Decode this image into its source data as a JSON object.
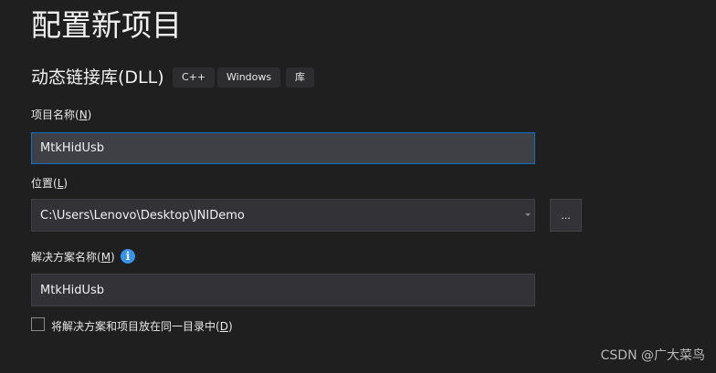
{
  "title": "配置新项目",
  "subtitle": "动态链接库(DLL)",
  "tags": [
    "C++",
    "Windows",
    "库"
  ],
  "project_name": {
    "label_pre": "项目名称(",
    "key": "N",
    "label_post": ")",
    "value": "MtkHidUsb"
  },
  "location": {
    "label_pre": "位置(",
    "key": "L",
    "label_post": ")",
    "value": "C:\\Users\\Lenovo\\Desktop\\JNIDemo",
    "browse_label": "..."
  },
  "solution_name": {
    "label_pre": "解决方案名称(",
    "key": "M",
    "label_post": ")",
    "value": "MtkHidUsb",
    "info_glyph": "i"
  },
  "same_dir": {
    "label_pre": "将解决方案和项目放在同一目录中(",
    "key": "D",
    "label_post": ")",
    "checked": false
  },
  "watermark": "CSDN @广大菜鸟"
}
